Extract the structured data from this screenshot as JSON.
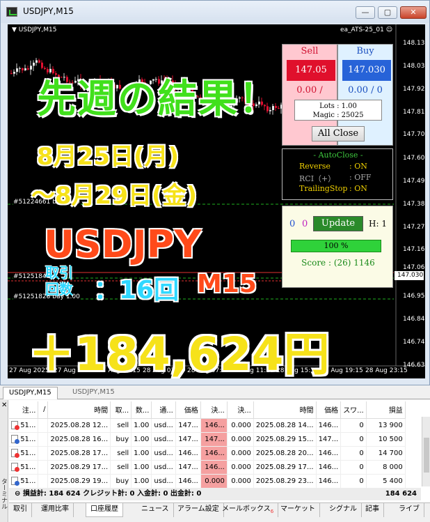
{
  "window": {
    "title": "USDJPY,M15"
  },
  "chart": {
    "symbol_label": "USDJPY,M15",
    "ea_label": "ea_ATS-25_01",
    "price_scale": [
      "148.135",
      "148.030",
      "147.920",
      "147.815",
      "147.705",
      "147.600",
      "147.490",
      "147.385",
      "147.275",
      "147.165",
      "147.060",
      "147.030",
      "146.955",
      "146.845",
      "146.740",
      "146.630"
    ],
    "time_labels": [
      "27 Aug 2025",
      "27 Aug 19:15",
      "27 Aug 23:15",
      "28 Aug 03:15",
      "28 Aug 07:15",
      "28 Aug 11:15",
      "28 Aug 15:15",
      "28 Aug 19:15",
      "28 Aug 23:15"
    ],
    "order_labels": [
      "#51224661 buy 1.00",
      "#51251846",
      "#51251828 buy 1.00"
    ],
    "current_price": "147.030"
  },
  "promo": {
    "headline": "先週の結果！",
    "date_from": "8月25日(月)",
    "date_to": "～8月29日(金)",
    "pair": "USDJPY",
    "trades_label_1": "取引",
    "trades_label_2": "回数",
    "trades_count": "：16回",
    "timeframe": "M15",
    "profit": "＋184,624円"
  },
  "ea_panel": {
    "sell_label": "Sell",
    "buy_label": "Buy",
    "sell_price": "147.05",
    "buy_price": "147.030",
    "sell_pl": "0.00 /",
    "buy_pl": "0.00 / 0",
    "lots": "Lots   : 1.00",
    "magic": "Magic : 25025",
    "all_close": "All Close",
    "autoclose_title": "- AutoClose -",
    "reverse_label": "Reverse",
    "reverse_val": ": ON",
    "rci_label": "RCI（+）",
    "rci_val": ": OFF",
    "trailing_label": "TrailingStop",
    "trailing_val": ": ON",
    "count_a": "0",
    "count_b": "0",
    "update": "Update",
    "h_label": "H: 1",
    "progress_text": "100 %",
    "progress": 1.0,
    "score": "Score : (26) 1146"
  },
  "chart_tabs": [
    "USDJPY,M15",
    "USDJPY,M15"
  ],
  "terminal": {
    "side_label": "ターミナル",
    "columns": [
      "注...",
      "/",
      "時間",
      "取...",
      "数...",
      "通...",
      "価格",
      "決...",
      "決...",
      "時間",
      "価格",
      "スワ...",
      "損益"
    ],
    "rows": [
      [
        "51...",
        "2025.08.28 12...",
        "sell",
        "1.00",
        "usd...",
        "147...",
        "146...",
        "0.000",
        "2025.08.28 14...",
        "146...",
        "0",
        "13 900",
        "sell"
      ],
      [
        "51...",
        "2025.08.28 16...",
        "buy",
        "1.00",
        "usd...",
        "147...",
        "147...",
        "0.000",
        "2025.08.29 15...",
        "147...",
        "0",
        "10 500",
        "buy"
      ],
      [
        "51...",
        "2025.08.28 17...",
        "sell",
        "1.00",
        "usd...",
        "146...",
        "146...",
        "0.000",
        "2025.08.28 20...",
        "146...",
        "0",
        "14 700",
        "sell"
      ],
      [
        "51...",
        "2025.08.29 17...",
        "sell",
        "1.00",
        "usd...",
        "147...",
        "146...",
        "0.000",
        "2025.08.29 17...",
        "146...",
        "0",
        "8 000",
        "sell"
      ],
      [
        "51...",
        "2025.08.29 19...",
        "buy",
        "1.00",
        "usd...",
        "146...",
        "0.000",
        "0.000",
        "2025.08.29 23...",
        "146...",
        "0",
        "5 400",
        "buy"
      ]
    ],
    "summary": "損益計: 184 624  クレジット計: 0  入金計: 0  出金計: 0",
    "summary_total": "184 624",
    "tabs": [
      "取引",
      "運用比率",
      "口座履歴",
      "ニュース",
      "アラーム設定",
      "メールボックス",
      "マーケット",
      "シグナル",
      "記事",
      "ライブ"
    ],
    "mail_badge": "6"
  }
}
